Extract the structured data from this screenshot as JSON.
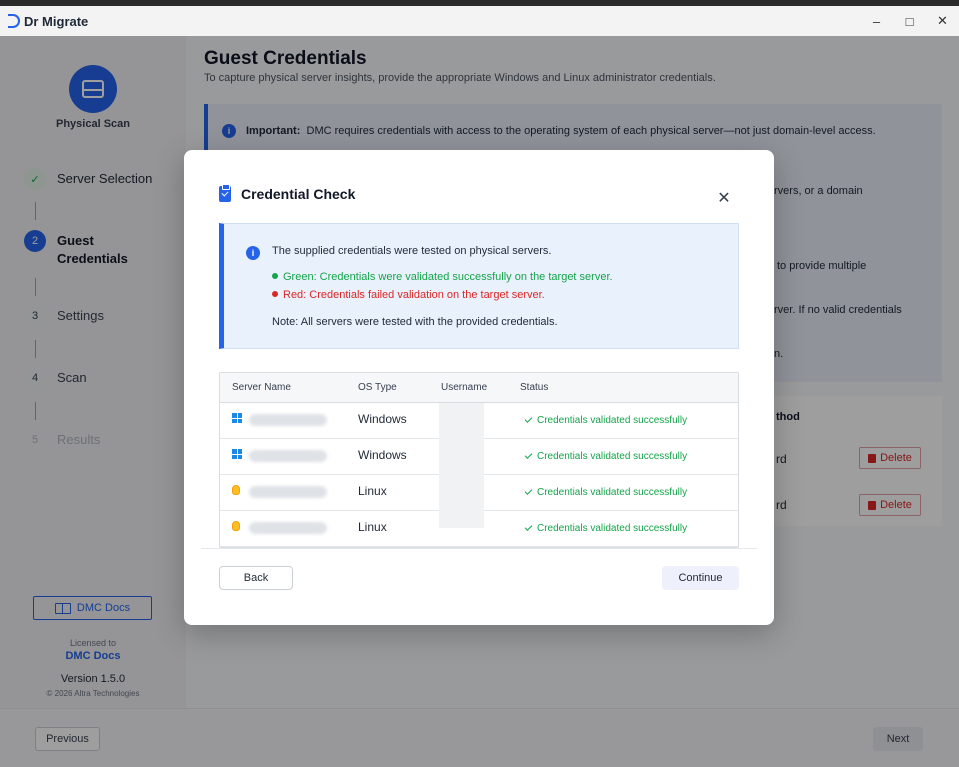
{
  "app": {
    "name": "Dr Migrate"
  },
  "window": {
    "minimize": "–",
    "maximize": "□",
    "close": "✕"
  },
  "sidebar": {
    "section_label": "Physical Scan",
    "steps": [
      {
        "num": "✓",
        "label": "Server Selection"
      },
      {
        "num": "2",
        "label": "Guest Credentials"
      },
      {
        "num": "3",
        "label": "Settings"
      },
      {
        "num": "4",
        "label": "Scan"
      },
      {
        "num": "5",
        "label": "Results"
      }
    ],
    "docs_button": "DMC Docs",
    "licensed_to_label": "Licensed to",
    "licensed_to": "DMC Docs",
    "version": "Version 1.5.0",
    "copyright": "© 2026 Altra Technologies"
  },
  "page": {
    "title": "Guest Credentials",
    "subtitle": "To capture physical server insights, provide the appropriate Windows and Linux administrator credentials.",
    "important_label": "Important:",
    "important_text": "DMC requires credentials with access to the operating system of each physical server—not just domain-level access.",
    "frag1": "rvers, or a domain",
    "frag2": "to provide multiple",
    "frag3": "rver. If no valid credentials",
    "frag4": "n.",
    "table_header_fragment": "thod",
    "row_fragment": "rd",
    "delete_label": "Delete"
  },
  "footer": {
    "previous": "Previous",
    "next": "Next"
  },
  "modal": {
    "title": "Credential Check",
    "close": "✕",
    "info_line1": "The supplied credentials were tested on physical servers.",
    "info_green": "Green: Credentials were validated successfully on the target server.",
    "info_red": "Red: Credentials failed validation on the target server.",
    "info_note": "Note: All servers were tested with the provided credentials.",
    "columns": [
      "Server Name",
      "OS Type",
      "Username",
      "Status"
    ],
    "rows": [
      {
        "os": "Windows",
        "os_icon": "windows-icon",
        "status": "Credentials validated successfully"
      },
      {
        "os": "Windows",
        "os_icon": "windows-icon",
        "status": "Credentials validated successfully"
      },
      {
        "os": "Linux",
        "os_icon": "linux-icon",
        "status": "Credentials validated successfully"
      },
      {
        "os": "Linux",
        "os_icon": "linux-icon",
        "status": "Credentials validated successfully"
      }
    ],
    "back": "Back",
    "continue": "Continue"
  }
}
